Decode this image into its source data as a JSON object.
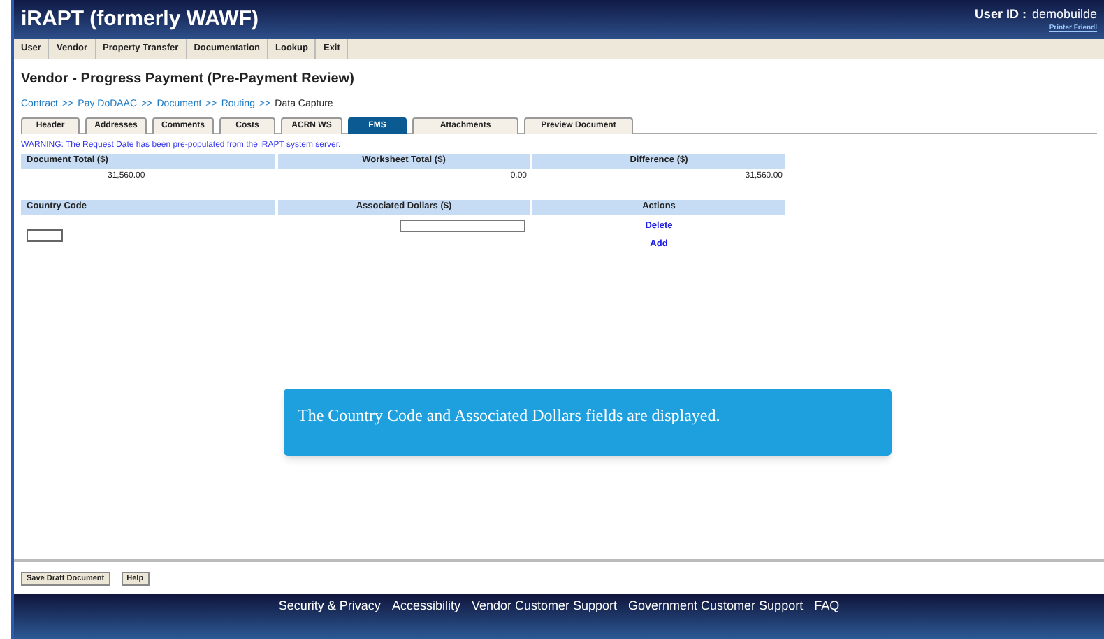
{
  "header": {
    "title": "iRAPT (formerly WAWF)",
    "user_label": "User ID :",
    "user_value": "demobuilde",
    "printer_link": "Printer Friendl"
  },
  "menu": [
    "User",
    "Vendor",
    "Property Transfer",
    "Documentation",
    "Lookup",
    "Exit"
  ],
  "page_title": "Vendor - Progress Payment (Pre-Payment Review)",
  "breadcrumb": [
    {
      "label": "Contract",
      "kind": "link"
    },
    {
      "label": ">>",
      "kind": "separator"
    },
    {
      "label": "Pay DoDAAC",
      "kind": "link"
    },
    {
      "label": ">>",
      "kind": "separator"
    },
    {
      "label": "Document",
      "kind": "link"
    },
    {
      "label": ">>",
      "kind": "separator"
    },
    {
      "label": "Routing",
      "kind": "link"
    },
    {
      "label": ">>",
      "kind": "separator"
    },
    {
      "label": "Data Capture",
      "kind": "current"
    }
  ],
  "tabs": [
    {
      "label": "Header",
      "selected": false
    },
    {
      "label": "Addresses",
      "selected": false
    },
    {
      "label": "Comments",
      "selected": false
    },
    {
      "label": "Costs",
      "selected": false
    },
    {
      "label": "ACRN WS",
      "selected": false
    },
    {
      "label": "FMS",
      "selected": true
    },
    {
      "label": "Attachments",
      "selected": false
    },
    {
      "label": "Preview Document",
      "selected": false
    }
  ],
  "warning": "WARNING: The Request Date has been pre-populated from the iRAPT system server.",
  "totals": {
    "columns": [
      "Document Total ($)",
      "Worksheet Total ($)",
      "Difference ($)"
    ],
    "values": [
      "31,560.00",
      "0.00",
      "31,560.00"
    ]
  },
  "fms_table": {
    "columns": [
      "Country Code",
      "Associated Dollars ($)",
      "Actions"
    ],
    "actions": [
      "Delete",
      "Add"
    ]
  },
  "callout": "The Country Code and Associated Dollars fields are displayed.",
  "buttons": [
    "Save Draft Document",
    "Help"
  ],
  "footer_links": [
    "Security & Privacy",
    "Accessibility",
    "Vendor Customer Support",
    "Government Customer Support",
    "FAQ"
  ]
}
